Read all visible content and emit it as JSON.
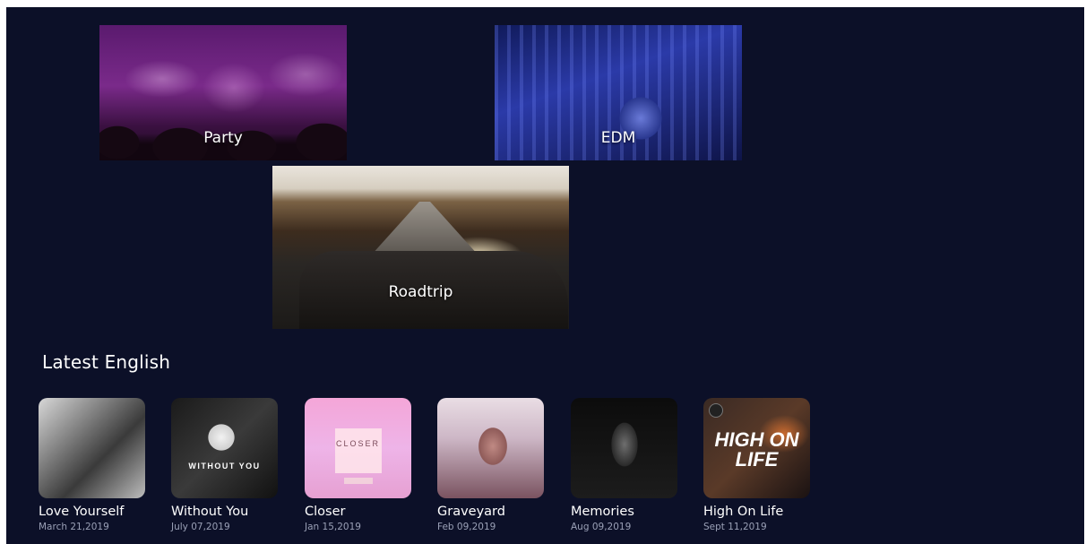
{
  "moods": [
    {
      "label": "Party"
    },
    {
      "label": "EDM"
    },
    {
      "label": "Roadtrip"
    }
  ],
  "section": {
    "title": "Latest English"
  },
  "songs": [
    {
      "title": "Love Yourself",
      "date": "March 21,2019"
    },
    {
      "title": "Without You",
      "date": "July 07,2019",
      "cover_text": "WITHOUT YOU"
    },
    {
      "title": "Closer",
      "date": "Jan 15,2019",
      "cover_text": "CLOSER"
    },
    {
      "title": "Graveyard",
      "date": "Feb 09,2019"
    },
    {
      "title": "Memories",
      "date": "Aug 09,2019"
    },
    {
      "title": "High On Life",
      "date": "Sept 11,2019",
      "cover_text": "HIGH ON LIFE"
    }
  ],
  "colors": {
    "background": "#0c1028",
    "text": "#ffffff",
    "muted": "#9aa0b6"
  }
}
